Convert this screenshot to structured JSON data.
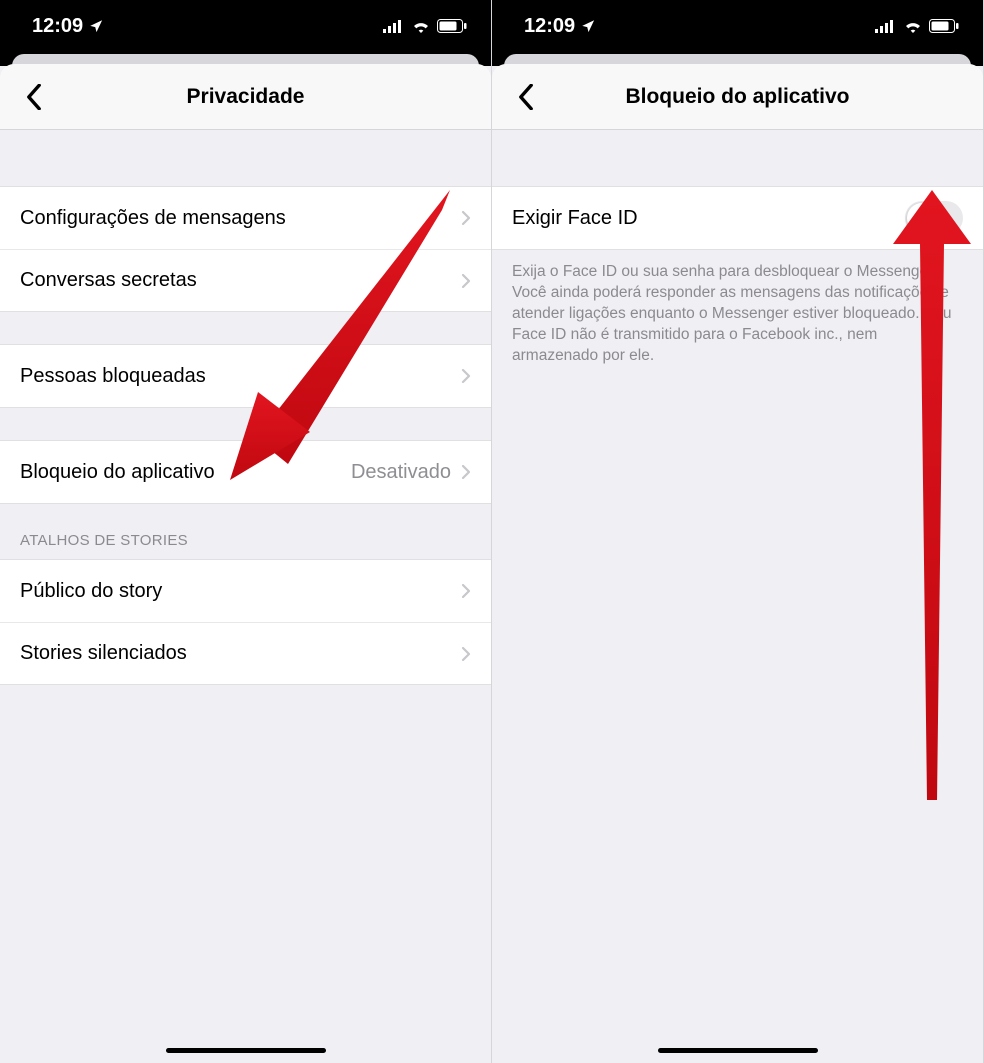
{
  "statusbar": {
    "time": "12:09"
  },
  "left": {
    "title": "Privacidade",
    "rows": {
      "messages": "Configurações de mensagens",
      "secret": "Conversas secretas",
      "blocked": "Pessoas bloqueadas",
      "applock": "Bloqueio do aplicativo",
      "applock_value": "Desativado"
    },
    "stories_header": "ATALHOS DE STORIES",
    "stories": {
      "audience": "Público do story",
      "muted": "Stories silenciados"
    }
  },
  "right": {
    "title": "Bloqueio do aplicativo",
    "toggle_label": "Exigir Face ID",
    "description": "Exija o Face ID ou sua senha para desbloquear o Messenger. Você ainda poderá responder as mensagens das notificações e atender ligações enquanto o Messenger estiver bloqueado. Seu Face ID não é transmitido para o Facebook inc., nem armazenado por ele."
  }
}
